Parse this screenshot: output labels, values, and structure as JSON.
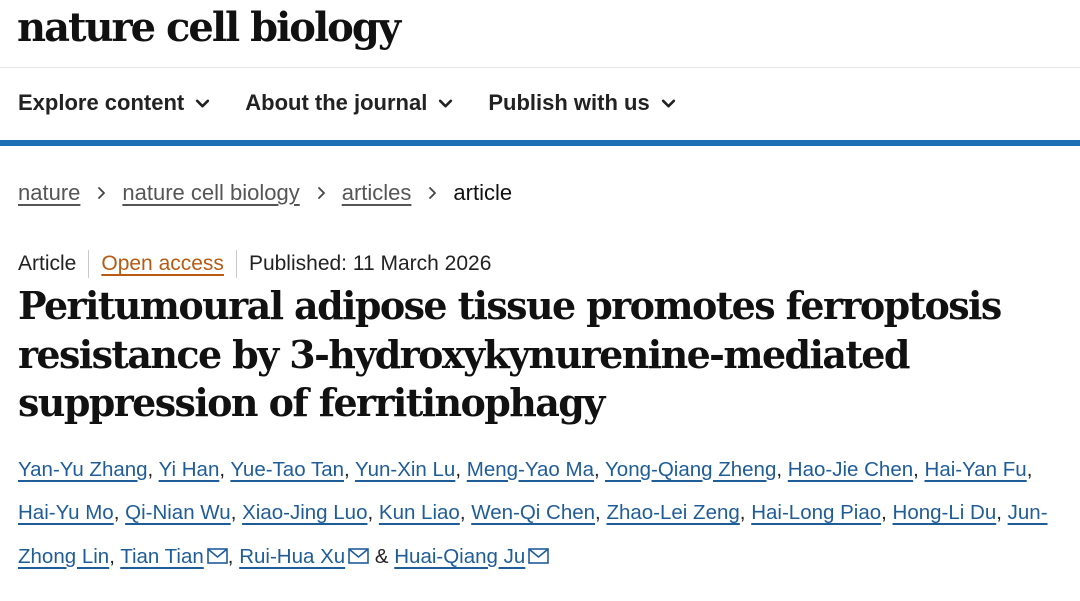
{
  "header": {
    "logo": "nature cell biology"
  },
  "nav": {
    "items": [
      {
        "label": "Explore content"
      },
      {
        "label": "About the journal"
      },
      {
        "label": "Publish with us"
      }
    ]
  },
  "breadcrumb": {
    "items": [
      "nature",
      "nature cell biology",
      "articles"
    ],
    "current": "article"
  },
  "article": {
    "type": "Article",
    "access": "Open access",
    "published": "Published: 11 March 2026",
    "title": "Peritumoural adipose tissue promotes ferroptosis resistance by 3-hydroxykynurenine-mediated suppression of ferritinophagy",
    "authors": [
      "Yan-Yu Zhang",
      "Yi Han",
      "Yue-Tao Tan",
      "Yun-Xin Lu",
      "Meng-Yao Ma",
      "Yong-Qiang Zheng",
      "Hao-Jie Chen",
      "Hai-Yan Fu",
      "Hai-Yu Mo",
      "Qi-Nian Wu",
      "Xiao-Jing Luo",
      "Kun Liao",
      "Wen-Qi Chen",
      "Zhao-Lei Zeng",
      "Hai-Long Piao",
      "Hong-Li Du",
      "Jun-Zhong Lin",
      "Tian Tian",
      "Rui-Hua Xu",
      "Huai-Qiang Ju"
    ],
    "authors_joiner": "&"
  },
  "colors": {
    "accent_blue": "#1f6fb4",
    "author_link": "#1f5d99",
    "open_access": "#b85a12"
  },
  "icons": {
    "nav_chevron": "chevron-down-icon",
    "breadcrumb_separator": "chevron-right-icon",
    "corresponding_author": "mail-icon"
  }
}
